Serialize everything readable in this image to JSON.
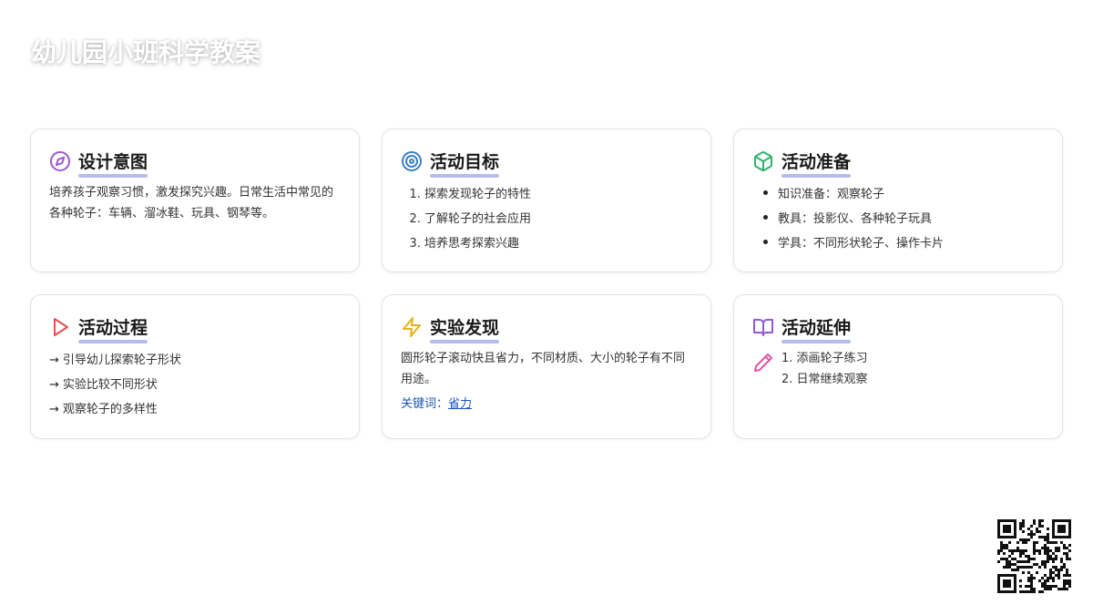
{
  "page": {
    "title": "幼儿园小班科学教案"
  },
  "cards": {
    "design": {
      "icon": "compass-icon",
      "title": "设计意图",
      "text": "培养孩子观察习惯，激发探究兴趣。日常生活中常见的各种轮子：车辆、溜冰鞋、玩具、钢琴等。"
    },
    "goals": {
      "icon": "target-icon",
      "title": "活动目标",
      "items": [
        "探索发现轮子的特性",
        "了解轮子的社会应用",
        "培养思考探索兴趣"
      ]
    },
    "prep": {
      "icon": "box-icon",
      "title": "活动准备",
      "items": [
        "知识准备：观察轮子",
        "教具：投影仪、各种轮子玩具",
        "学具：不同形状轮子、操作卡片"
      ]
    },
    "process": {
      "icon": "play-icon",
      "title": "活动过程",
      "arrow": "→",
      "items": [
        "引导幼儿探索轮子形状",
        "实验比较不同形状",
        "观察轮子的多样性"
      ]
    },
    "findings": {
      "icon": "lightning-icon",
      "title": "实验发现",
      "text": "圆形轮子滚动快且省力，不同材质、大小的轮子有不同用途。",
      "keyword_label": "关键词：",
      "keyword": "省力"
    },
    "extension": {
      "icon": "book-icon",
      "title": "活动延伸",
      "pencil_icon": "pencil-icon",
      "items": [
        "1. 添画轮子练习",
        "2. 日常继续观察"
      ]
    }
  },
  "colors": {
    "compass": "#9b59d6",
    "target": "#3b7fc4",
    "box": "#2fb36a",
    "play": "#e05252",
    "lightning": "#e3b21a",
    "book": "#8e5ad6",
    "pencil": "#e055a8",
    "title_underline": "#b7bcea",
    "link": "#1a56b8"
  },
  "qr": {
    "icon": "qr-code-icon"
  }
}
